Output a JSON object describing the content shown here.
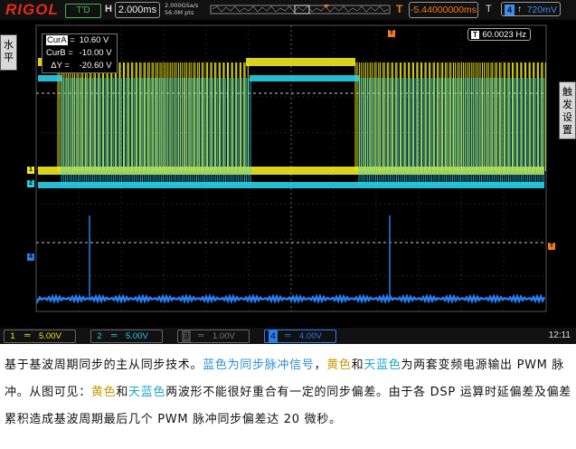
{
  "scope": {
    "brand": "RIGOL",
    "run_state": "T'D",
    "horizontal": {
      "label": "H",
      "timebase": "2.000ms",
      "sample_rate": "2.000GSa/s",
      "memory_depth": "56.0M pts"
    },
    "trigger": {
      "label": "T",
      "position": "-5.44000000ms",
      "source_label": "T",
      "source_channel": "4",
      "edge_symbol": "↑",
      "level": "720mV"
    },
    "left_tab": {
      "label": "水平"
    },
    "right_tabs": [
      {
        "label": "触发设置"
      }
    ],
    "cursor": {
      "a_label": "CurA",
      "a_value": "10.60 V",
      "b_label": "CurB",
      "b_value": "-10.00 V",
      "dy_label": "ΔY",
      "dy_value": "-20.60 V"
    },
    "freq_counter": {
      "icon": "T",
      "value": "60.0023 Hz"
    },
    "channel_markers": {
      "ch1": "1",
      "ch2": "2",
      "ch4": "4",
      "trigger_level": "T",
      "trigger_pos": "T"
    },
    "channels": [
      {
        "num": "1",
        "coupling": "═",
        "scale": "5.00V",
        "color": "#f0e91f",
        "active": true
      },
      {
        "num": "2",
        "coupling": "═",
        "scale": "5.00V",
        "color": "#27d0e8",
        "active": true
      },
      {
        "num": "3",
        "coupling": "═",
        "scale": "1.00V",
        "color": "#666666",
        "active": false
      },
      {
        "num": "4",
        "coupling": "═",
        "scale": "4.00V",
        "color": "#2a7ef0",
        "active": true
      }
    ],
    "clock": "12:11",
    "colors": {
      "ch1": "#f0e91f",
      "ch2": "#27d0e8",
      "ch4": "#2a7ef0",
      "trigger": "#f07a1c",
      "brand": "#e8281c"
    }
  },
  "caption": {
    "s1": "基于基波周期同步的主从同步技术。",
    "s2_blue": "蓝色为同步脉冲信号",
    "s3": "，",
    "s4_yellow": "黄色",
    "s5": "和",
    "s6_cyan": "天蓝色",
    "s7": "为两套变频电源输出 PWM 脉冲。从图可见：",
    "s8_yellow": "黄色",
    "s9": "和",
    "s10_cyan": "天蓝色",
    "s11": "两波形不能很好重合有一定的同步偏差。由于各 DSP 运算时延偏差及偏差累积造成基波周期最后几个 PWM 脉冲同步偏差达 20 微秒。"
  }
}
